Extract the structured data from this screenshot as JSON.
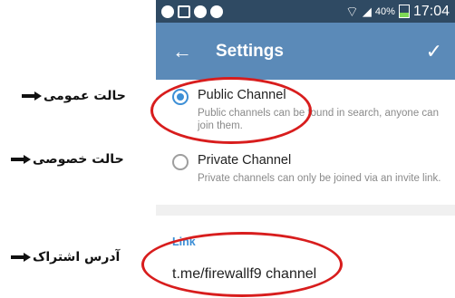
{
  "status_bar": {
    "battery_percent": "40%",
    "time": "17:04"
  },
  "toolbar": {
    "back_icon": "←",
    "title": "Settings",
    "confirm_icon": "✓"
  },
  "options": [
    {
      "title": "Public Channel",
      "description": "Public channels can be found in search, anyone can join them.",
      "selected": true
    },
    {
      "title": "Private Channel",
      "description": "Private channels can only be joined via an invite link.",
      "selected": false
    }
  ],
  "link": {
    "label": "Link",
    "value": "t.me/firewallf9 channel"
  },
  "annotations": {
    "public": "حالت عمومی",
    "private": "حالت خصوصی",
    "link": "آدرس اشتراک"
  },
  "colors": {
    "toolbar": "#5b8ab8",
    "status_bar": "#2f4a63",
    "accent": "#3d8fd6",
    "highlight": "#d81d1d"
  }
}
